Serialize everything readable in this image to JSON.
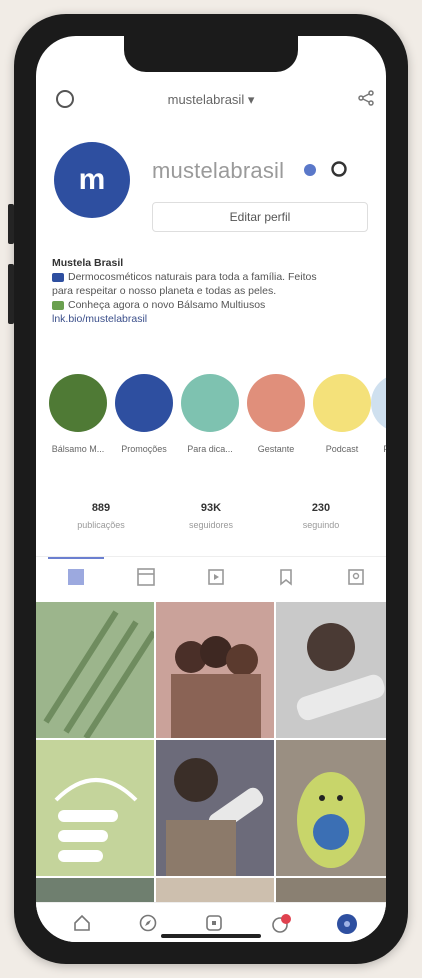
{
  "header": {
    "username": "mustelabrasil",
    "chevron": "▾"
  },
  "profile": {
    "avatar_letter": "m",
    "display_name": "mustelabrasil",
    "edit_label": "Editar perfil"
  },
  "bio": {
    "name": "Mustela Brasil",
    "line1": "Dermocosméticos naturais para toda a família. Feitos",
    "line2": "para respeitar o nosso planeta e todas as peles.",
    "line3": "Conheça agora o novo Bálsamo Multiusos",
    "link": "lnk.bio/mustelabrasil"
  },
  "stories": [
    {
      "label": "Bálsamo M...",
      "color": "#4f7a35"
    },
    {
      "label": "Promoções",
      "color": "#2e4fa0"
    },
    {
      "label": "Para dica...",
      "color": "#7ec2b0"
    },
    {
      "label": "Gestante",
      "color": "#e08f7b"
    },
    {
      "label": "Podcast",
      "color": "#f4e17a"
    },
    {
      "label": "Para c...",
      "color": "#cfe0ef"
    }
  ],
  "stats": [
    {
      "number": "889",
      "label": "publicações"
    },
    {
      "number": "93K",
      "label": "seguidores"
    },
    {
      "number": "230",
      "label": "seguindo"
    }
  ],
  "tabs": [
    "grid",
    "reels",
    "video",
    "saved",
    "tagged"
  ],
  "grid": [
    {
      "bg": "#9cb58c"
    },
    {
      "bg": "#caa29a"
    },
    {
      "bg": "#c9c9c9"
    },
    {
      "bg": "#c4d49b"
    },
    {
      "bg": "#6c6b7a"
    },
    {
      "bg": "#9a8f82"
    },
    {
      "bg": "#6f7f6f"
    },
    {
      "bg": "#cdbfae"
    },
    {
      "bg": "#8a8072"
    }
  ],
  "bottom_nav": [
    "home-icon",
    "explore-icon",
    "add-icon",
    "notifications-icon",
    "profile-icon"
  ],
  "notification_count": "2"
}
